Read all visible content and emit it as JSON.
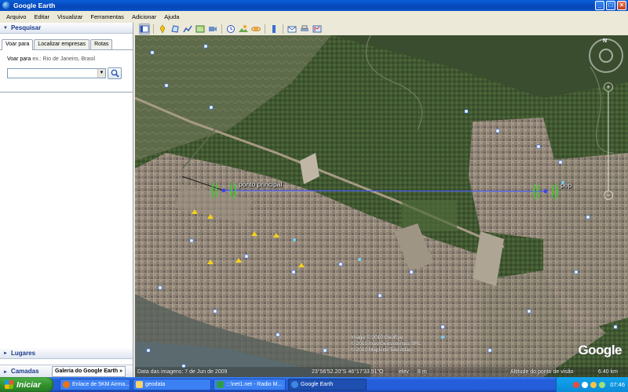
{
  "window": {
    "title": "Google Earth",
    "minimize": "_",
    "maximize": "□",
    "close": "×"
  },
  "menu": [
    "Arquivo",
    "Editar",
    "Visualizar",
    "Ferramentas",
    "Adicionar",
    "Ajuda"
  ],
  "toolbar": {
    "icons": [
      "sidebar-icon",
      "placemark-icon",
      "polygon-icon",
      "path-icon",
      "image-overlay-icon",
      "record-tour-icon",
      "historical-imagery-icon",
      "sunlight-icon",
      "planets-icon",
      "ruler-icon",
      "email-icon",
      "print-icon",
      "maps-icon"
    ]
  },
  "search": {
    "header": "Pesquisar",
    "tabs": [
      "Voar para",
      "Localizar empresas",
      "Rotas"
    ],
    "fly_label": "Voar para",
    "fly_hint": "ex.: Rio de Janeiro, Brasil",
    "input_value": "",
    "dropdown_glyph": "▼"
  },
  "places": {
    "header": "Lugares"
  },
  "layers": {
    "header": "Camadas",
    "gallery_label": "Galeria do Google Earth",
    "gallery_arrow": "»"
  },
  "map": {
    "labels": {
      "main_point": "ponto principal",
      "pop": "pop"
    },
    "google_logo": "Google",
    "credits": [
      "Image © 2010 GeoEye",
      "© 2010 Inav/Geosistemas SRL",
      "© 2010 MapLink/Tele Atlas"
    ],
    "status": {
      "imagery_date": "Data das imagens:  7 de Jun de 2009",
      "coords": "23°56'52.20\"S    46°17'33.91\"O",
      "elev": "elev",
      "elev_value": "8 m",
      "eye_alt": "Altitude do ponto de visão",
      "eye_alt_value": "6.40 km"
    },
    "nav_north": "N",
    "zoom_plus": "+",
    "zoom_minus": "−"
  },
  "taskbar": {
    "start": "Iniciar",
    "tasks": [
      {
        "label": "Enlace de 5KM Airma...",
        "color": "#e8741e"
      },
      {
        "label": "geodata",
        "color": "#f6d36b"
      },
      {
        "label": ":::\\net1.net - Radio M...",
        "color": "#2f9d47"
      },
      {
        "label": "Google Earth",
        "color": "#3d88e0"
      }
    ],
    "clock": "07:46"
  },
  "colors": {
    "link_line": "#4b5cff",
    "signal": "#3ad02a",
    "link_line_dark": "#1a1a1a"
  }
}
